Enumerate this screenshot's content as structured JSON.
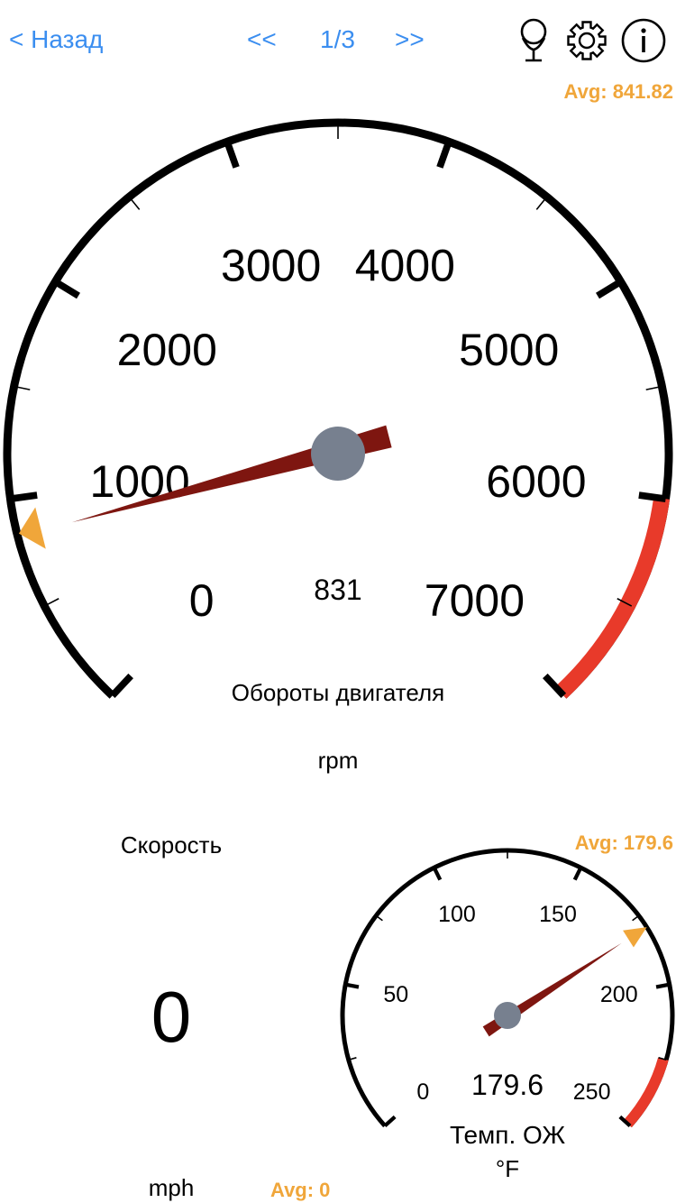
{
  "nav": {
    "back_label": "< Назад",
    "prev_label": "<<",
    "page_indicator": "1/3",
    "next_label": ">>",
    "icons": [
      "microphone-icon",
      "gear-icon",
      "info-icon"
    ]
  },
  "rpm_gauge": {
    "avg_label": "Avg: 841.82",
    "value": 831,
    "value_label": "831",
    "avg_value": 841.82,
    "min": 0,
    "max": 7000,
    "redline_start": 6000,
    "tick_labels": [
      "0",
      "1000",
      "2000",
      "3000",
      "4000",
      "5000",
      "6000",
      "7000"
    ],
    "title": "Обороты двигателя",
    "unit": "rpm"
  },
  "speed": {
    "label": "Скорость",
    "value": "0",
    "unit": "mph",
    "avg_label": "Avg: 0"
  },
  "temp_gauge": {
    "avg_label": "Avg: 179.6",
    "value": 179.6,
    "value_label": "179.6",
    "avg_value": 179.6,
    "min": 0,
    "max": 250,
    "redline_start": 225,
    "tick_labels": [
      "0",
      "50",
      "100",
      "150",
      "200",
      "250"
    ],
    "title": "Темп. ОЖ",
    "unit": "°F"
  },
  "colors": {
    "accent_blue": "#3b8ef0",
    "avg_orange": "#f0a63a",
    "redline": "#e83a2a",
    "needle": "#7e1610",
    "hub": "#77808f"
  }
}
